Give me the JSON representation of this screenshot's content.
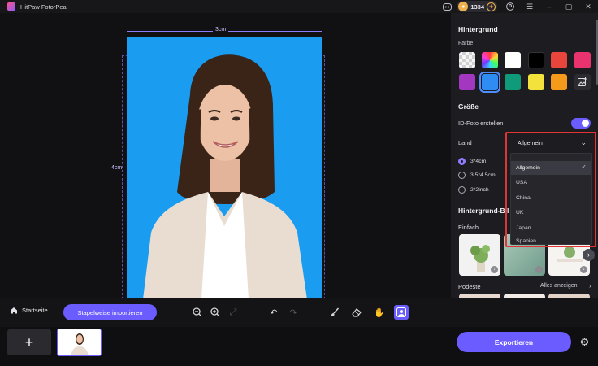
{
  "app": {
    "title": "HitPaw FotorPea",
    "credits": "1334"
  },
  "canvas": {
    "width_label": "3cm",
    "height_label": "4cm"
  },
  "panel": {
    "background_title": "Hintergrund",
    "color_label": "Farbe",
    "colors": [
      "transparent",
      "rainbow",
      "#ffffff",
      "#000000",
      "#e8453c",
      "#e8336f",
      "#a337c0",
      "#2f8cf2",
      "#0f9a7a",
      "#f4e23c",
      "#f59a1a",
      "custom-image"
    ],
    "size_title": "Größe",
    "id_photo_label": "ID-Foto erstellen",
    "id_photo_enabled": true,
    "country_label": "Land",
    "country_selected": "Allgemein",
    "countries": [
      "Allgemein",
      "USA",
      "China",
      "UK",
      "Japan",
      "Spanien"
    ],
    "sizes": [
      "3*4cm",
      "3.5*4.5cm",
      "2*2inch"
    ],
    "size_selected": "3*4cm",
    "bg_image_title": "Hintergrund-Bil",
    "simple_label": "Einfach",
    "podest_label": "Podeste",
    "show_all": "Alles anzeigen"
  },
  "toolbar": {
    "home_label": "Startseite",
    "batch_label": "Stapelweise importieren"
  },
  "bottom": {
    "export_label": "Exportieren"
  },
  "accent": "#6a5cff"
}
